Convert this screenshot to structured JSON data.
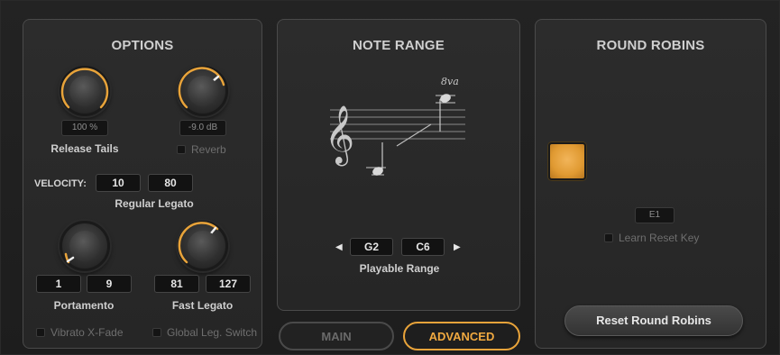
{
  "options": {
    "title": "OPTIONS",
    "release_tails": {
      "value": "100 %",
      "label": "Release Tails",
      "level": 1.0
    },
    "reverb": {
      "value": "-9.0 dB",
      "label": "Reverb",
      "level": 0.8
    },
    "velocity": {
      "label": "VELOCITY:",
      "low": "10",
      "high": "80",
      "sublabel": "Regular Legato"
    },
    "portamento": {
      "low": "1",
      "high": "9",
      "label": "Portamento"
    },
    "fast_legato": {
      "low": "81",
      "high": "127",
      "label": "Fast Legato"
    },
    "vibrato_xfade": {
      "label": "Vibrato X-Fade"
    },
    "global_leg_switch": {
      "label": "Global Leg. Switch"
    }
  },
  "note_range": {
    "title": "NOTE RANGE",
    "octave_mark": "8va",
    "low": "G2",
    "high": "C6",
    "label": "Playable Range"
  },
  "tabs": {
    "main": "MAIN",
    "advanced": "ADVANCED"
  },
  "round_robins": {
    "title": "ROUND ROBINS",
    "reset_key_value": "E1",
    "learn_label": "Learn Reset Key",
    "reset_button": "Reset Round Robins"
  },
  "colors": {
    "accent": "#e8a33a",
    "panel": "#2a2a2a",
    "border": "#4a4a4a"
  }
}
